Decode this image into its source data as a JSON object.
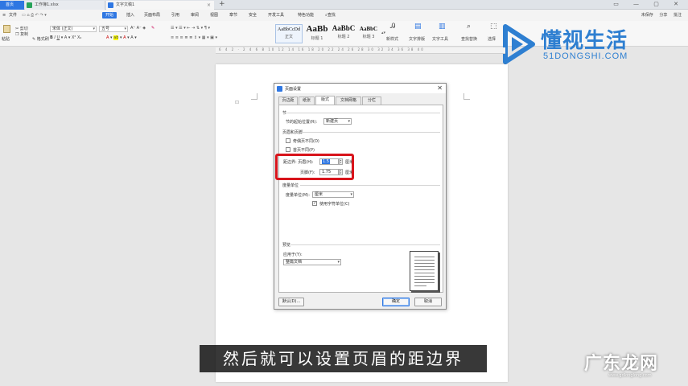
{
  "tabbar": {
    "home": "首页",
    "tab_xlsx": "工作簿1.xlsx",
    "tab_doc": "文字文稿1",
    "new_tab": "+",
    "window_controls": "▭ — ▢ ✕"
  },
  "menubar": {
    "file": "文件",
    "items": [
      "开始",
      "插入",
      "页面布局",
      "引用",
      "审阅",
      "视图",
      "章节",
      "安全",
      "开发工具",
      "特色功能"
    ],
    "search": "查找",
    "right": [
      "未保存",
      "分享",
      "批注"
    ]
  },
  "toolbar": {
    "paste": "粘贴",
    "cut": "剪切",
    "copy": "复制",
    "format_painter": "格式刷",
    "font_name": "宋体 (正文)",
    "font_size": "五号",
    "styles": [
      {
        "sample": "AaBbCcDd",
        "name": "正文"
      },
      {
        "sample": "AaBb",
        "name": "标题 1"
      },
      {
        "sample": "AaBbC",
        "name": "标题 2"
      },
      {
        "sample": "AaBbC",
        "name": "标题 3"
      }
    ],
    "new_style": "新样式",
    "text_layout": "文字排版",
    "text_tools": "文字工具",
    "find_replace": "查找替换",
    "select": "选择"
  },
  "ruler": {
    "numbers": "6  4  2  ·  2  4  6  8  10  12  14  16  18  20  22  24  26  28  30  32  34  36  38  40"
  },
  "logo": {
    "title": "懂视生活",
    "subtitle": "51DONGSHI.COM",
    "brand_color": "#2e7fd1"
  },
  "dialog": {
    "title": "页面设置",
    "close": "✕",
    "tabs": [
      "页边距",
      "纸张",
      "版式",
      "文档网格",
      "分栏"
    ],
    "active_tab": 2,
    "section": {
      "label": "节",
      "start_label": "节的起始位置(R):",
      "start_value": "新建页"
    },
    "header_footer": {
      "label": "页眉和页脚",
      "odd_even": "奇偶页不同(O)",
      "first_page": "首页不同(P)",
      "header_label": "距边界: 页眉(H):",
      "header_value": "1.5",
      "header_unit": "厘米",
      "footer_label": "页脚(F):",
      "footer_value": "1.75",
      "footer_unit": "厘米"
    },
    "units": {
      "label": "度量单位",
      "unit_label": "度量单位(M):",
      "unit_value": "厘米",
      "use_char": "使用字符单位(C)",
      "use_char_checked": true
    },
    "preview": {
      "label": "预览",
      "apply_label": "应用于(Y):",
      "apply_value": "整篇文档"
    },
    "buttons": {
      "default": "默认(D)...",
      "ok": "确定",
      "cancel": "取消"
    }
  },
  "subtitle": "然后就可以设置页眉的距边界",
  "watermark": {
    "title": "广东龙网",
    "subtitle": "www.gdlonglong.com"
  }
}
